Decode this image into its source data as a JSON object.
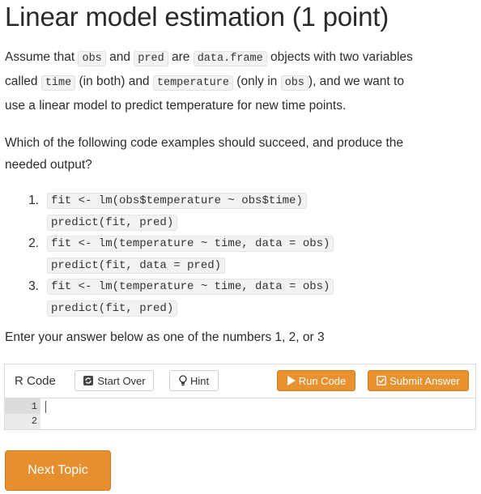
{
  "title": "Linear model estimation (1 point)",
  "intro": {
    "line1": {
      "t1": "Assume that ",
      "c1": "obs",
      "t2": " and ",
      "c2": "pred",
      "t3": " are ",
      "c3": "data.frame",
      "t4": " objects with two variables"
    },
    "line2": {
      "t1": "called ",
      "c1": "time",
      "t2": " (in both) and ",
      "c2": "temperature",
      "t3": " (only in ",
      "c3": "obs",
      "t4": "), and we want to"
    },
    "line3": "use a linear model to predict temperature for new time points."
  },
  "question": {
    "line1": "Which of the following code examples should succeed, and produce the",
    "line2": "needed output?"
  },
  "options": [
    {
      "number": "1.",
      "code1": "fit <- lm(obs$temperature ~ obs$time)",
      "code2": "predict(fit, pred)"
    },
    {
      "number": "2.",
      "code1": "fit <- lm(temperature ~ time, data = obs)",
      "code2": "predict(fit, data = pred)"
    },
    {
      "number": "3.",
      "code1": "fit <- lm(temperature ~ time, data = obs)",
      "code2": "predict(fit, pred)"
    }
  ],
  "instruction": "Enter your answer below as one of the numbers 1, 2, or 3",
  "editor": {
    "label": "R Code",
    "start_over": "Start Over",
    "hint": "Hint",
    "run_code": "Run Code",
    "submit": "Submit Answer",
    "line_numbers": [
      "1",
      "2"
    ],
    "content": ""
  },
  "next_topic": "Next Topic",
  "colors": {
    "accent": "#e8912f",
    "code_bg": "#f2f2f2",
    "gutter": "#ebebeb"
  }
}
